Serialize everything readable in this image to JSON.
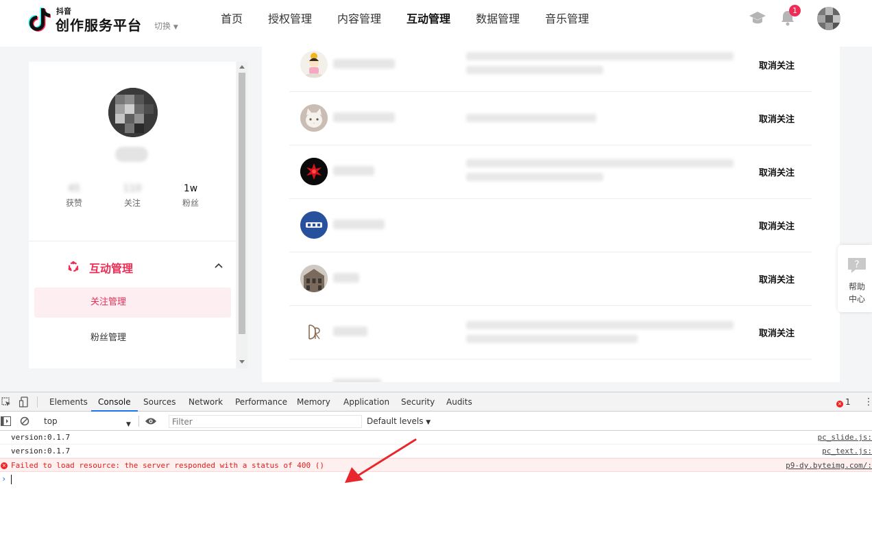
{
  "header": {
    "logo_small": "抖音",
    "logo_main": "创作服务平台",
    "switch_label": "切换",
    "nav": [
      {
        "label": "首页",
        "active": false
      },
      {
        "label": "授权管理",
        "active": false
      },
      {
        "label": "内容管理",
        "active": false
      },
      {
        "label": "互动管理",
        "active": true
      },
      {
        "label": "数据管理",
        "active": false
      },
      {
        "label": "音乐管理",
        "active": false
      }
    ],
    "notification_count": "1",
    "icons": [
      "graduation-cap-icon",
      "bell-icon"
    ]
  },
  "profile": {
    "stats": [
      {
        "value": "45",
        "label": "获赞",
        "blurred": true
      },
      {
        "value": "110",
        "label": "关注",
        "blurred": true
      },
      {
        "value": "1w",
        "label": "粉丝",
        "blurred": false
      }
    ]
  },
  "sidebar": {
    "group_label": "互动管理",
    "items": [
      {
        "label": "关注管理",
        "active": true
      },
      {
        "label": "粉丝管理",
        "active": false
      }
    ]
  },
  "follow_list": {
    "action_label": "取消关注",
    "rows": [
      {
        "avatar": "cartoon-girl",
        "desc_lines": 2
      },
      {
        "avatar": "white-cat",
        "desc_lines": 1
      },
      {
        "avatar": "red-dragon",
        "desc_lines": 2
      },
      {
        "avatar": "blue-badge",
        "desc_lines": 0
      },
      {
        "avatar": "building",
        "desc_lines": 0
      },
      {
        "avatar": "dr-logo",
        "desc_lines": 2
      }
    ]
  },
  "help": {
    "line1": "帮助",
    "line2": "中心"
  },
  "devtools": {
    "tabs": [
      {
        "label": "Elements",
        "active": false
      },
      {
        "label": "Console",
        "active": true
      },
      {
        "label": "Sources",
        "active": false
      },
      {
        "label": "Network",
        "active": false
      },
      {
        "label": "Performance",
        "active": false
      },
      {
        "label": "Memory",
        "active": false
      },
      {
        "label": "Application",
        "active": false
      },
      {
        "label": "Security",
        "active": false
      },
      {
        "label": "Audits",
        "active": false
      }
    ],
    "error_count": "1",
    "context": "top",
    "filter_placeholder": "Filter",
    "levels": "Default levels",
    "logs": [
      {
        "message": "version:0.1.7",
        "source": "pc_slide.js:",
        "type": "log"
      },
      {
        "message": "version:0.1.7",
        "source": "pc_text.js:",
        "type": "log"
      },
      {
        "message": "Failed to load resource: the server responded with a status of 400 ()",
        "source": "p9-dy.byteimg.com/:",
        "type": "error"
      }
    ],
    "prompt": "›"
  },
  "colors": {
    "accent": "#ee2c55",
    "devtools_active": "#1a73e8",
    "error_text": "#e21d1d",
    "annotation_arrow": "#e8262b"
  }
}
